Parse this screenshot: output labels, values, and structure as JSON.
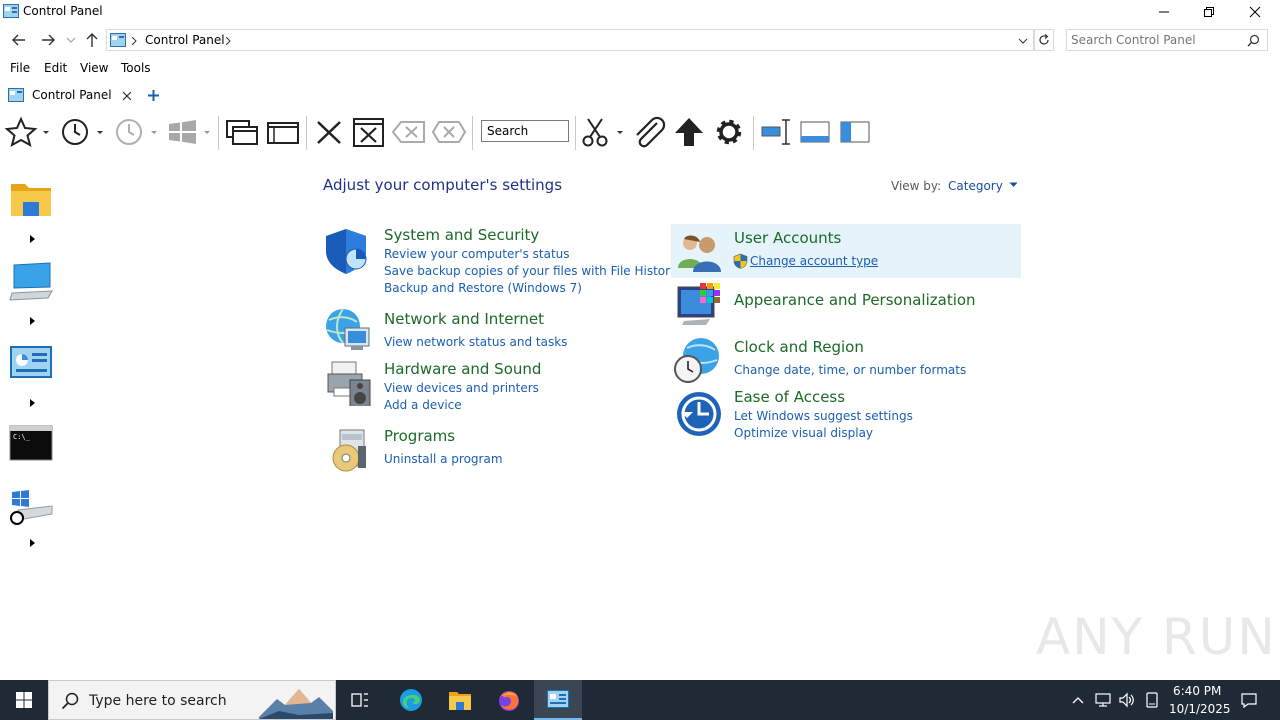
{
  "window": {
    "title": "Control Panel"
  },
  "address": {
    "breadcrumb": "Control Panel",
    "search_placeholder": "Search Control Panel"
  },
  "menu": [
    "File",
    "Edit",
    "View",
    "Tools"
  ],
  "tabs": [
    {
      "label": "Control Panel"
    }
  ],
  "toolbar": {
    "search_label": "Search"
  },
  "main": {
    "heading": "Adjust your computer's settings",
    "view_by_label": "View by:",
    "view_by_value": "Category",
    "left_categories": [
      {
        "title": "System and Security",
        "links": [
          "Review your computer's status",
          "Save backup copies of your files with File History",
          "Backup and Restore (Windows 7)"
        ]
      },
      {
        "title": "Network and Internet",
        "links": [
          "View network status and tasks"
        ]
      },
      {
        "title": "Hardware and Sound",
        "links": [
          "View devices and printers",
          "Add a device"
        ]
      },
      {
        "title": "Programs",
        "links": [
          "Uninstall a program"
        ]
      }
    ],
    "right_categories": [
      {
        "title": "User Accounts",
        "links": [
          "Change account type"
        ]
      },
      {
        "title": "Appearance and Personalization",
        "links": []
      },
      {
        "title": "Clock and Region",
        "links": [
          "Change date, time, or number formats"
        ]
      },
      {
        "title": "Ease of Access",
        "links": [
          "Let Windows suggest settings",
          "Optimize visual display"
        ]
      }
    ]
  },
  "taskbar": {
    "search_placeholder": "Type here to search",
    "time": "6:40 PM",
    "date": "10/1/2025"
  },
  "watermark": "ANY RUN",
  "colors": {
    "heading": "#1e3287",
    "category_title": "#1c6a27",
    "link": "#1a5fb4",
    "highlight": "#e5f3fb",
    "taskbar": "#1f2a36"
  }
}
